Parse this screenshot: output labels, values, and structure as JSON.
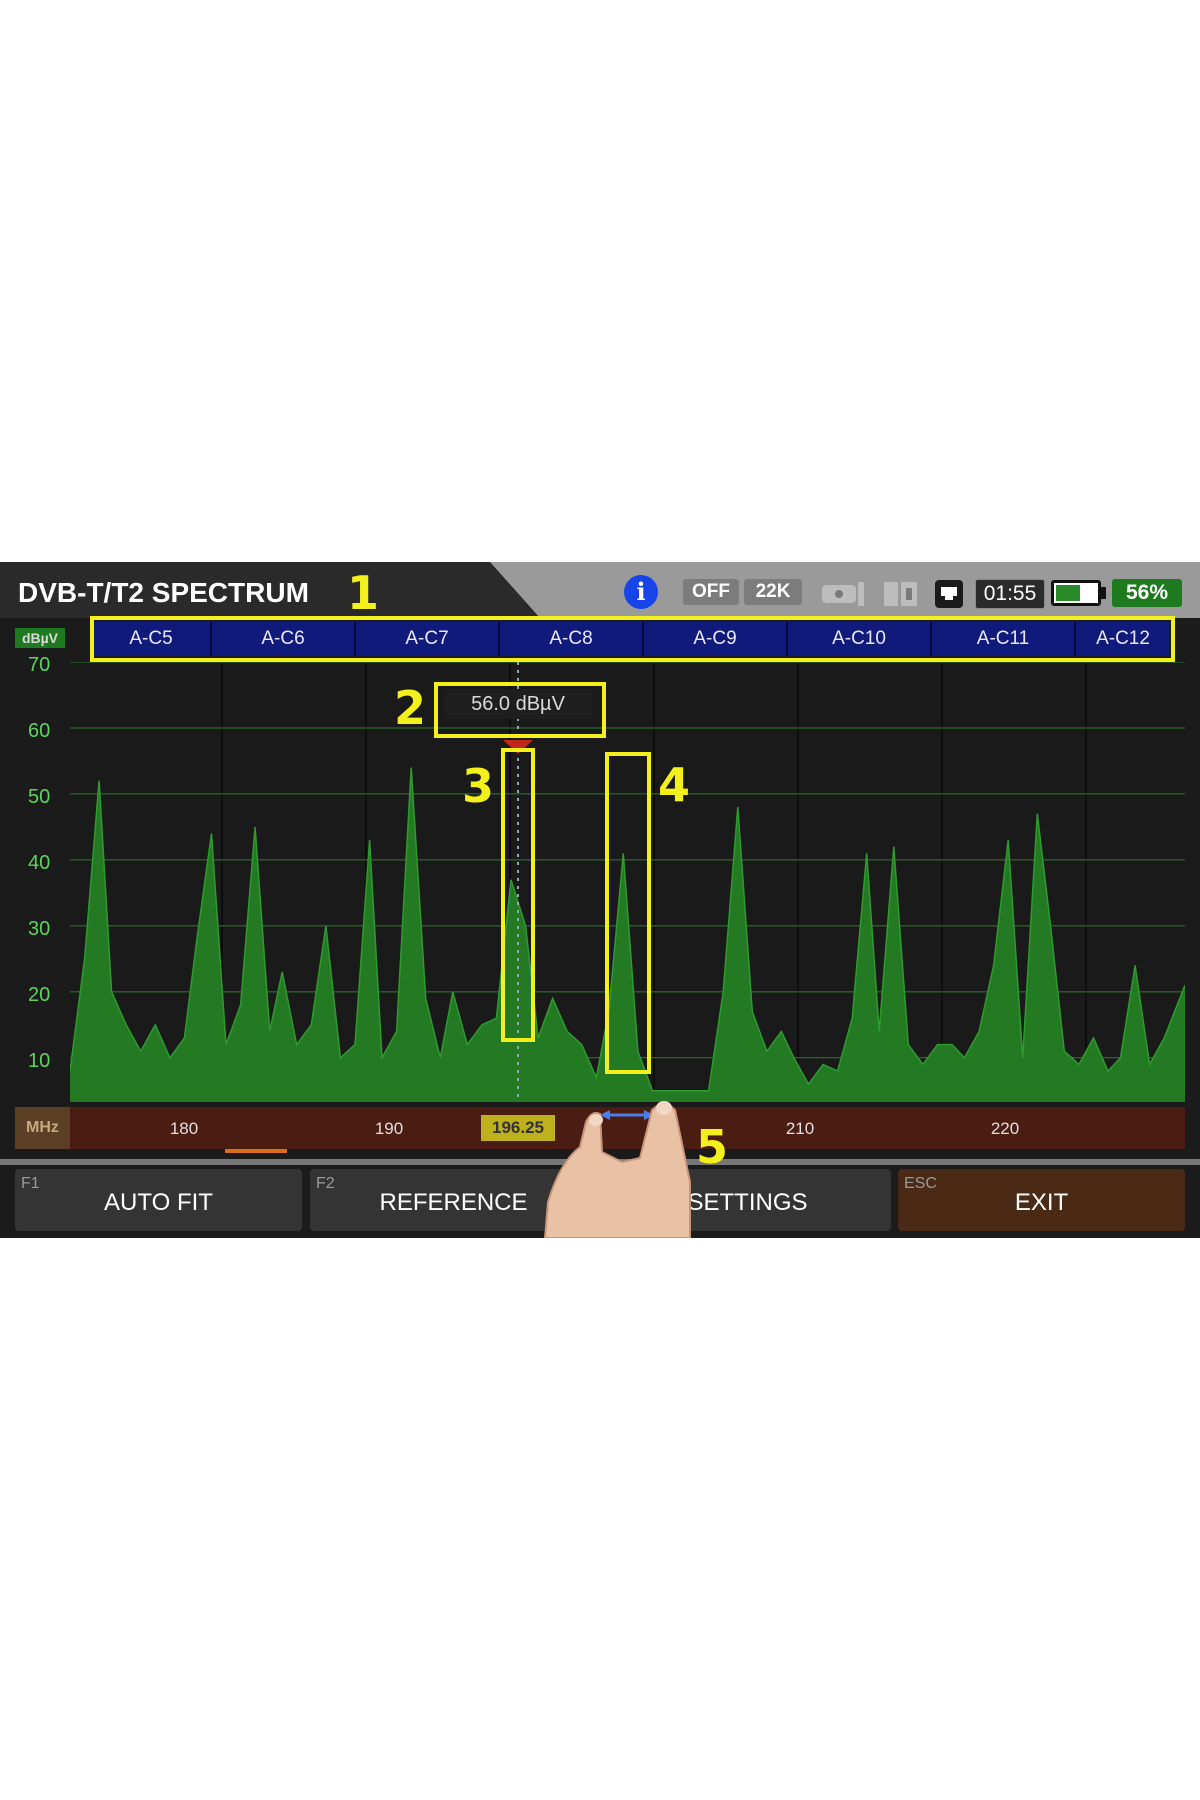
{
  "header": {
    "title": "DVB-T/T2 SPECTRUM",
    "lnb_power": "OFF",
    "tone": "22K",
    "time": "01:55",
    "battery_percent": "56%",
    "battery_level": 0.56
  },
  "icons": [
    "info-icon",
    "lnb-icon",
    "dual-sim-icon",
    "ethernet-icon",
    "battery-icon"
  ],
  "channel_bar": {
    "unit": "dBµV",
    "channels": [
      "A-C5",
      "A-C6",
      "A-C7",
      "A-C8",
      "A-C9",
      "A-C10",
      "A-C11",
      "A-C12"
    ]
  },
  "y_axis": {
    "ticks": [
      "70",
      "60",
      "50",
      "40",
      "30",
      "20",
      "10"
    ]
  },
  "x_axis": {
    "unit": "MHz",
    "ticks": [
      "180",
      "190",
      "210",
      "220"
    ],
    "partial_tick": "2"
  },
  "marker": {
    "frequency": "196.25",
    "level": "56.0 dBµV"
  },
  "function_keys": [
    {
      "code": "F1",
      "label": "AUTO FIT"
    },
    {
      "code": "F2",
      "label": "REFERENCE"
    },
    {
      "code": "F3",
      "label": "SETTINGS"
    },
    {
      "code": "ESC",
      "label": "EXIT"
    }
  ],
  "annotations": [
    "1",
    "2",
    "3",
    "4",
    "5"
  ],
  "colors": {
    "trace": "#237a23",
    "grid": "#2e7d2e",
    "channel_bar": "#101a7a",
    "annotation": "#f3f01c",
    "marker_triangle": "#c0281c",
    "exit_key": "#4a2a14"
  },
  "chart_data": {
    "type": "area",
    "xlabel": "MHz",
    "ylabel": "dBµV",
    "xlim": [
      174.6,
      228.2
    ],
    "ylim": [
      3.3,
      70
    ],
    "x": [
      174.6,
      175.3,
      176.0,
      176.6,
      177.3,
      178.0,
      178.7,
      179.4,
      180.1,
      180.7,
      181.4,
      182.1,
      182.8,
      183.5,
      184.2,
      184.8,
      185.5,
      186.2,
      186.9,
      187.6,
      188.3,
      189.0,
      189.6,
      190.3,
      191.0,
      191.7,
      192.4,
      193.0,
      193.7,
      194.4,
      195.1,
      195.8,
      196.5,
      197.1,
      197.8,
      198.5,
      199.2,
      199.9,
      200.5,
      201.2,
      201.9,
      202.6,
      203.3,
      204.0,
      204.6,
      205.3,
      206.0,
      206.7,
      207.4,
      208.1,
      208.8,
      209.4,
      210.1,
      210.8,
      211.5,
      212.2,
      212.9,
      213.5,
      214.2,
      214.9,
      215.6,
      216.3,
      217.0,
      217.6,
      218.3,
      219.0,
      219.7,
      220.4,
      221.1,
      221.7,
      222.4,
      223.1,
      223.8,
      224.5,
      225.1,
      225.8,
      226.5,
      227.2,
      228.2
    ],
    "series": [
      {
        "values": [
          8,
          25,
          52,
          20,
          15,
          11,
          15,
          10,
          13,
          28,
          44,
          12,
          18,
          45,
          14,
          23,
          12,
          15,
          30,
          10,
          12,
          43,
          10,
          14,
          54,
          19,
          10,
          20,
          12,
          15,
          16,
          37,
          30,
          13,
          19,
          14,
          12,
          7,
          17,
          41,
          11,
          5,
          5,
          5,
          5,
          5,
          20,
          48,
          17,
          11,
          14,
          10,
          6,
          9,
          8,
          16,
          41,
          14,
          42,
          12,
          9,
          12,
          12,
          10,
          14,
          24,
          43,
          10,
          47,
          31,
          11,
          9,
          13,
          8,
          10,
          24,
          9,
          13,
          21
        ]
      }
    ]
  }
}
